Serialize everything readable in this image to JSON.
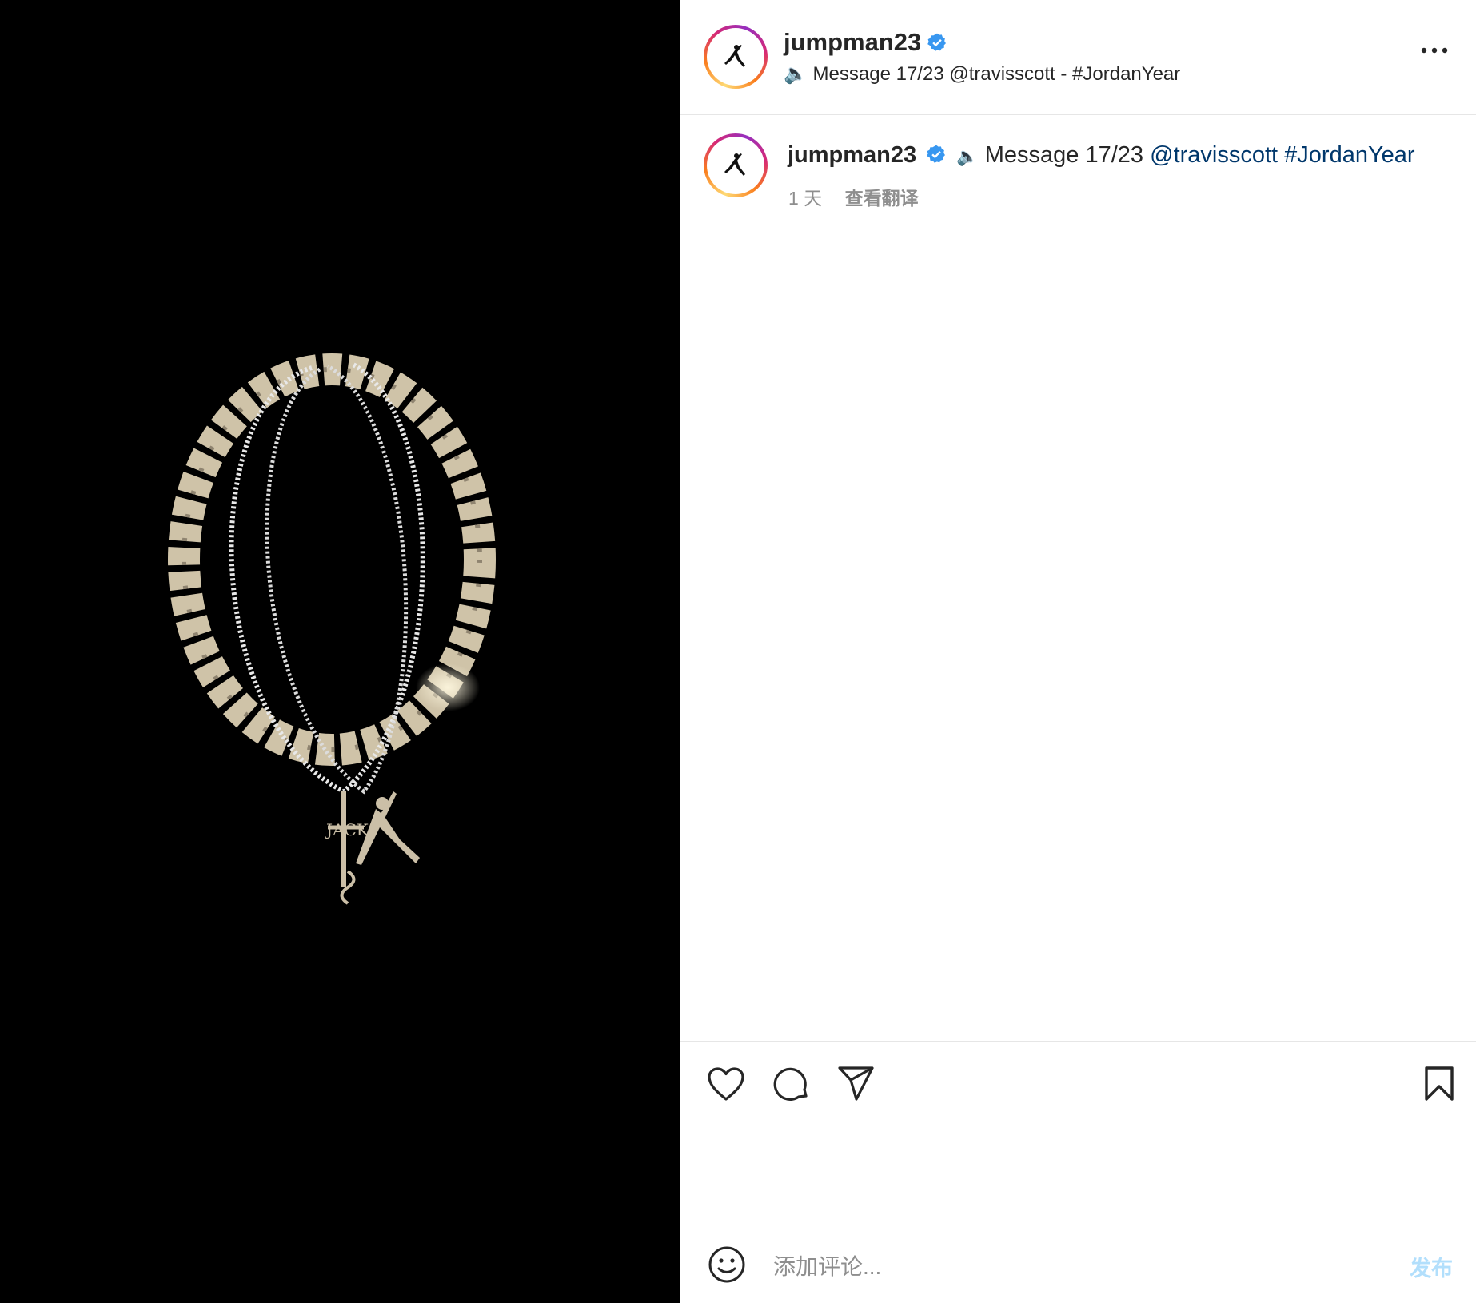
{
  "post": {
    "username": "jumpman23",
    "verified": true,
    "header_subtitle": "🔈 Message 17/23 @travisscott - #JordanYear",
    "caption": {
      "emoji": "🔈",
      "text": "Message 17/23",
      "mention": "@travisscott",
      "hashtag": "#JordanYear"
    },
    "time_ago": "1 天",
    "translate_label": "查看翻译"
  },
  "media": {
    "description_icon": "necklace-image",
    "pendant_text": "JACK"
  },
  "actions": {
    "like_icon": "heart-icon",
    "comment_icon": "comment-icon",
    "share_icon": "send-icon",
    "save_icon": "bookmark-icon"
  },
  "comment_box": {
    "placeholder": "添加评论...",
    "post_label": "发布",
    "emoji_icon": "smiley-icon"
  },
  "colors": {
    "link": "#00376b",
    "verified": "#3897f0",
    "post_button_disabled": "#b2dffc",
    "meta_text": "#8e8e8e"
  }
}
